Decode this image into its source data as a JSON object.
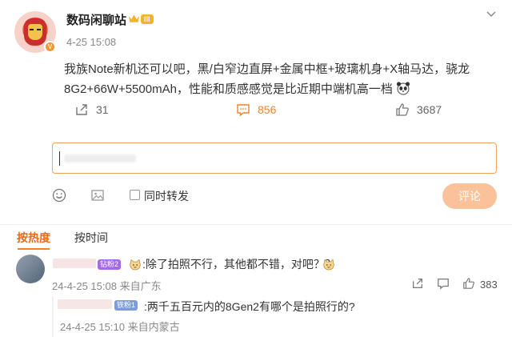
{
  "post": {
    "username": "数码闲聊站",
    "level_badge": "III",
    "timestamp": "4-25 15:08",
    "text": "我族Note新机还可以吧，黑/白窄边直屏+金属中框+玻璃机身+X轴马达，骁龙8G2+66W+5500mAh，性能和质感感觉是比近期中端机高一档",
    "reposts": "31",
    "comments": "856",
    "likes": "3687"
  },
  "composer": {
    "also_repost_label": "同时转发",
    "submit_label": "评论"
  },
  "comment_tabs": {
    "hot": "按热度",
    "time": "按时间"
  },
  "comments": [
    {
      "badge": "钻粉2",
      "text": ":除了拍照不行，其他都不错，对吧？？",
      "meta": "24-4-25 15:08 来自广东",
      "likes": "383"
    }
  ],
  "reply": {
    "badge": "铁粉1",
    "text": ":两千五百元内的8Gen2有哪个是拍照行的?",
    "meta": "24-4-25 15:10 来自内蒙古"
  },
  "colors": {
    "accent": "#f08328",
    "submit_disabled": "#f9c29b"
  }
}
